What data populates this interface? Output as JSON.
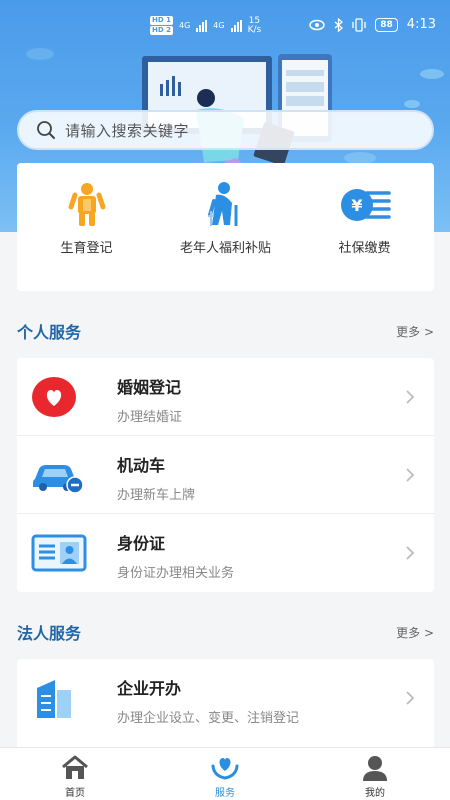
{
  "status_bar": {
    "network_badges": [
      "HD 1",
      "HD 2"
    ],
    "signal_labels": [
      "4G",
      "4G"
    ],
    "speed_value": "15",
    "speed_unit": "K/s",
    "battery": "88",
    "time": "4:13"
  },
  "search": {
    "placeholder": "请输入搜索关键字"
  },
  "quick_services": [
    {
      "label": "生育登记",
      "icon": "child-registration-icon"
    },
    {
      "label": "老年人福利补贴",
      "icon": "elderly-subsidy-icon"
    },
    {
      "label": "社保缴费",
      "icon": "social-security-payment-icon"
    }
  ],
  "personal_section": {
    "title": "个人服务",
    "more": "更多 >",
    "items": [
      {
        "title": "婚姻登记",
        "subtitle": "办理结婚证",
        "icon": "marriage-heart-icon"
      },
      {
        "title": "机动车",
        "subtitle": "办理新车上牌",
        "icon": "car-icon"
      },
      {
        "title": "身份证",
        "subtitle": "身份证办理相关业务",
        "icon": "id-card-icon"
      }
    ]
  },
  "legal_section": {
    "title": "法人服务",
    "more": "更多 >",
    "items": [
      {
        "title": "企业开办",
        "subtitle": "办理企业设立、变更、注销登记",
        "icon": "enterprise-building-icon"
      }
    ]
  },
  "bottom_nav": {
    "items": [
      {
        "label": "首页",
        "icon": "home-icon"
      },
      {
        "label": "服务",
        "icon": "service-heart-hands-icon"
      },
      {
        "label": "我的",
        "icon": "profile-icon"
      }
    ],
    "active": "服务"
  },
  "colors": {
    "accent": "#2a8fe0",
    "section_title": "#2266a8",
    "hero_top": "#4a9bea",
    "marriage_red": "#e8282e",
    "icon_blue": "#2d8fe3",
    "icon_orange": "#f5a623"
  }
}
